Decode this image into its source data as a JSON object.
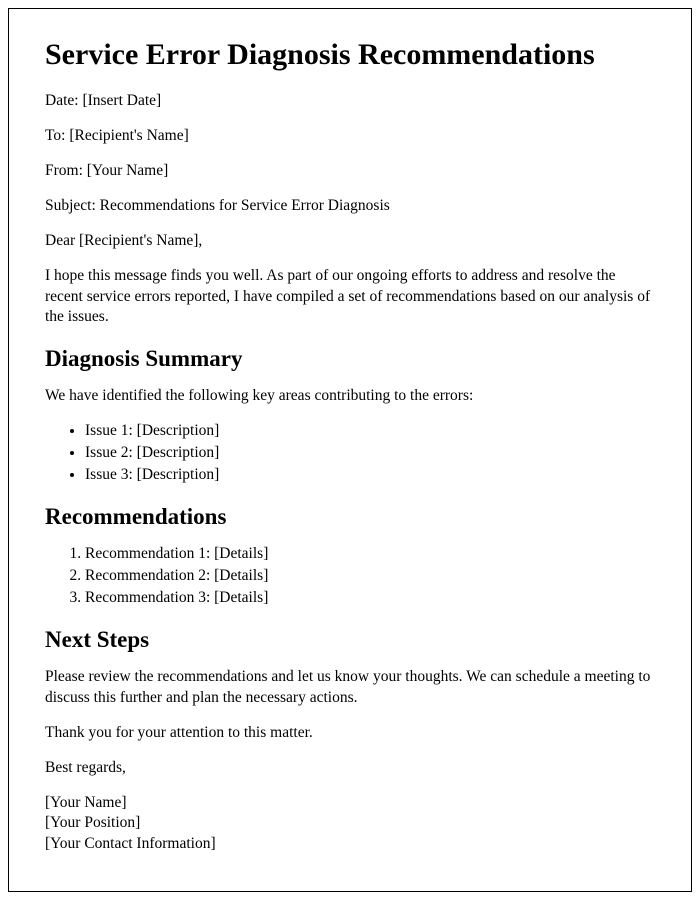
{
  "title": "Service Error Diagnosis Recommendations",
  "meta": {
    "date": "Date: [Insert Date]",
    "to": "To: [Recipient's Name]",
    "from": "From: [Your Name]",
    "subject": "Subject: Recommendations for Service Error Diagnosis"
  },
  "salutation": "Dear [Recipient's Name],",
  "intro": "I hope this message finds you well. As part of our ongoing efforts to address and resolve the recent service errors reported, I have compiled a set of recommendations based on our analysis of the issues.",
  "sections": {
    "diagnosis": {
      "heading": "Diagnosis Summary",
      "lead": "We have identified the following key areas contributing to the errors:",
      "items": [
        "Issue 1: [Description]",
        "Issue 2: [Description]",
        "Issue 3: [Description]"
      ]
    },
    "recommendations": {
      "heading": "Recommendations",
      "items": [
        "Recommendation 1: [Details]",
        "Recommendation 2: [Details]",
        "Recommendation 3: [Details]"
      ]
    },
    "nextsteps": {
      "heading": "Next Steps",
      "body": "Please review the recommendations and let us know your thoughts. We can schedule a meeting to discuss this further and plan the necessary actions."
    }
  },
  "thanks": "Thank you for your attention to this matter.",
  "closing": "Best regards,",
  "signature": {
    "name": "[Your Name]",
    "position": "[Your Position]",
    "contact": "[Your Contact Information]"
  }
}
